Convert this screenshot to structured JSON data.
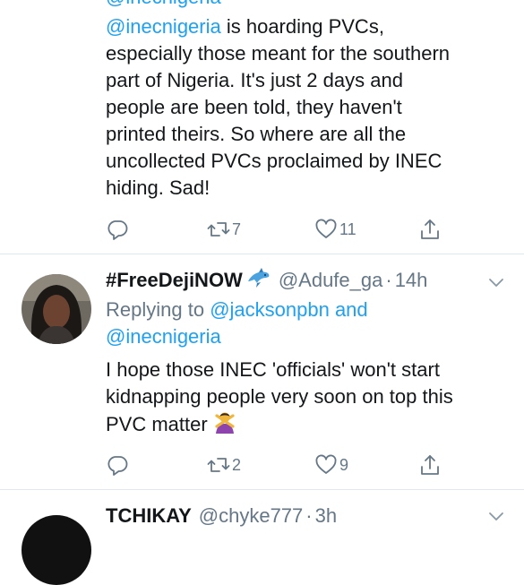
{
  "tweet1": {
    "partial_top": "@inecnigeria",
    "mention": "@inecnigeria",
    "lines": [
      " is hoarding PVCs,",
      "especially those meant for the southern",
      "part of Nigeria. It's just 2 days and",
      "people are been told, they haven't",
      "printed theirs. So where are all the",
      "uncollected PVCs proclaimed by INEC",
      "hiding. Sad!"
    ],
    "retweets": "7",
    "likes": "11"
  },
  "tweet2": {
    "name": "#FreeDejiNOW",
    "handle": "@Adufe_ga",
    "sep": "·",
    "time": "14h",
    "replying_prefix": "Replying to ",
    "replying_user1": "@jacksonpbn",
    "replying_and": " and",
    "replying_user2": "@inecnigeria",
    "lines": [
      "I hope those INEC 'officials' won't start",
      "kidnapping people very soon on top this",
      "PVC matter "
    ],
    "retweets": "2",
    "likes": "9"
  },
  "tweet3": {
    "name": "TCHIKAY",
    "handle": "@chyke777",
    "sep": "·",
    "time": "3h"
  },
  "icons": {
    "reply": "reply-icon",
    "retweet": "retweet-icon",
    "like": "heart-icon",
    "share": "share-icon",
    "more": "chevron-down-icon",
    "badge": "dolphin-emoji",
    "gesture": "person-gesturing-no-emoji"
  },
  "colors": {
    "link": "#1da1f2",
    "secondary": "#657786",
    "text": "#14171a",
    "divider": "#e1e8ed"
  }
}
